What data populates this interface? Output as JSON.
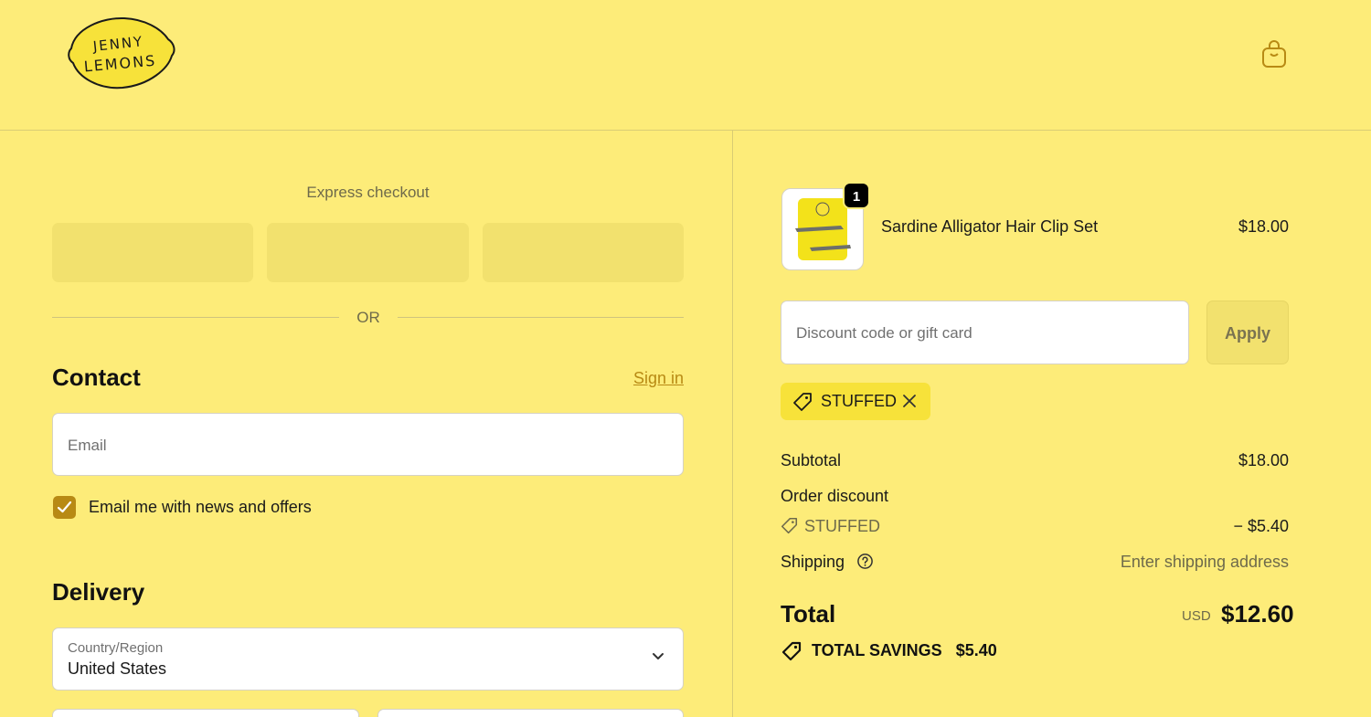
{
  "brand": {
    "logo_line1": "JENNY",
    "logo_line2": "LEMONS"
  },
  "colors": {
    "background": "#fdec79",
    "accent": "#b88a14",
    "chip": "#f7e23a"
  },
  "express": {
    "title": "Express checkout",
    "or": "OR"
  },
  "contact": {
    "heading": "Contact",
    "signin": "Sign in",
    "email_placeholder": "Email",
    "newsletter_label": "Email me with news and offers",
    "newsletter_checked": true
  },
  "delivery": {
    "heading": "Delivery",
    "country_label": "Country/Region",
    "country_value": "United States"
  },
  "cart": {
    "item": {
      "name": "Sardine Alligator Hair Clip Set",
      "price": "$18.00",
      "quantity": "1"
    },
    "discount_placeholder": "Discount code or gift card",
    "apply": "Apply",
    "applied_code": "STUFFED"
  },
  "summary": {
    "subtotal_label": "Subtotal",
    "subtotal_value": "$18.00",
    "order_discount_label": "Order discount",
    "discount_code": "STUFFED",
    "discount_value": "− $5.40",
    "shipping_label": "Shipping",
    "shipping_value": "Enter shipping address",
    "total_label": "Total",
    "total_currency": "USD",
    "total_value": "$12.60",
    "savings_label": "TOTAL SAVINGS",
    "savings_value": "$5.40"
  },
  "icons": {
    "cart": "shopping-bag-icon",
    "tag": "tag-icon",
    "close": "close-icon",
    "help": "help-circle-icon",
    "chevron": "chevron-down-icon",
    "check": "check-icon"
  }
}
